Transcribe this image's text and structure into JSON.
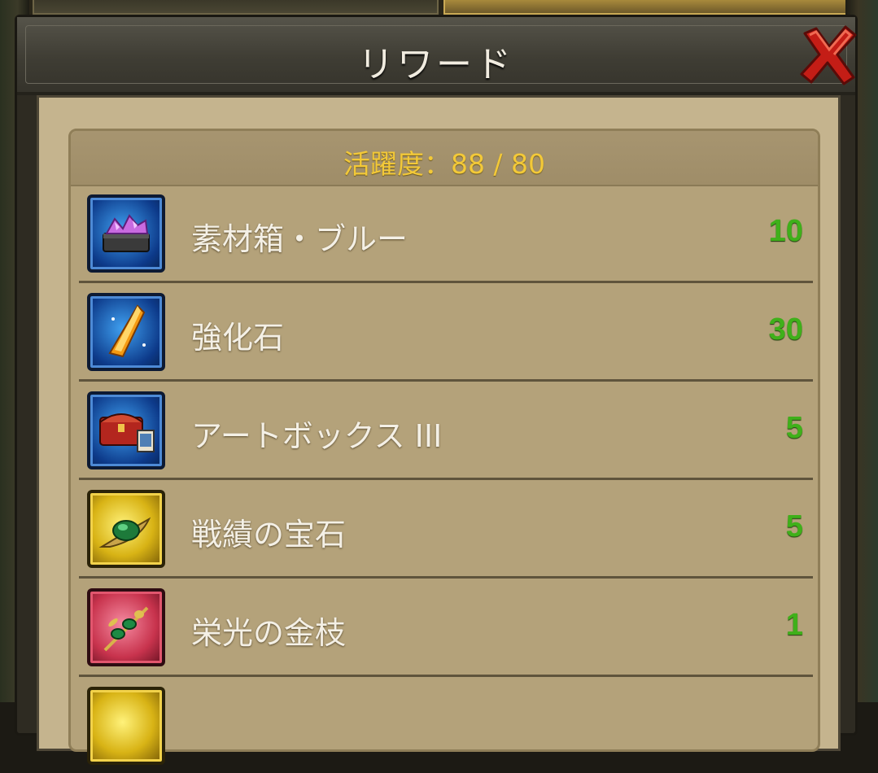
{
  "window": {
    "title": "リワード"
  },
  "activity": {
    "label": "活躍度：88 / 80"
  },
  "rewards": [
    {
      "name": "素材箱・ブルー",
      "count": "10",
      "icon": "material-box-icon",
      "frame": "blue"
    },
    {
      "name": "強化石",
      "count": "30",
      "icon": "enhancement-stone-icon",
      "frame": "blue"
    },
    {
      "name": "アートボックス III",
      "count": "5",
      "icon": "art-box-icon",
      "frame": "blue"
    },
    {
      "name": "戦績の宝石",
      "count": "5",
      "icon": "battle-gem-icon",
      "frame": "gold"
    },
    {
      "name": "栄光の金枝",
      "count": "1",
      "icon": "golden-branch-icon",
      "frame": "red"
    }
  ],
  "colors": {
    "count_green": "#3fb01a",
    "activity_gold": "#f3c938",
    "close_red": "#d8231b"
  }
}
